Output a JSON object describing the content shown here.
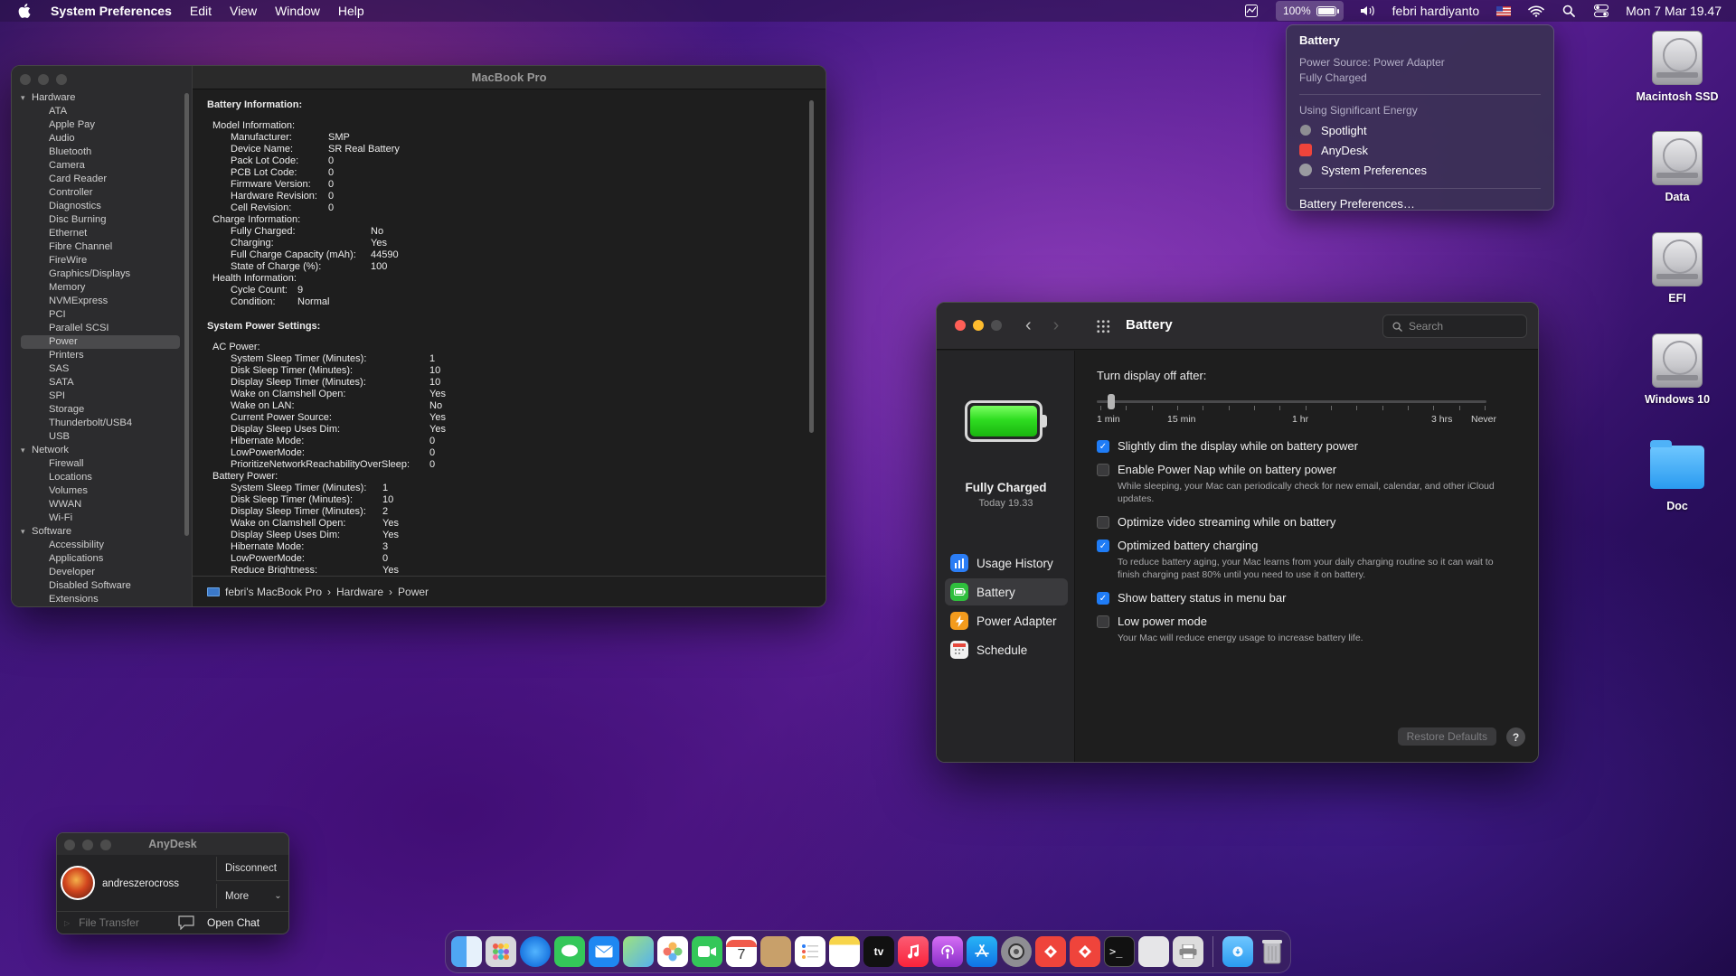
{
  "menubar": {
    "app_name": "System Preferences",
    "menus": [
      "Edit",
      "View",
      "Window",
      "Help"
    ],
    "battery_percent": "100%",
    "user": "febri hardiyanto",
    "datetime": "Mon 7 Mar  19.47"
  },
  "battery_menu": {
    "title": "Battery",
    "power_source": "Power Source: Power Adapter",
    "status": "Fully Charged",
    "energy_header": "Using Significant Energy",
    "apps": [
      "Spotlight",
      "AnyDesk",
      "System Preferences"
    ],
    "footer": "Battery Preferences…"
  },
  "sysinfo": {
    "window_title": "MacBook Pro",
    "tree": {
      "hardware_label": "Hardware",
      "hardware": [
        "ATA",
        "Apple Pay",
        "Audio",
        "Bluetooth",
        "Camera",
        "Card Reader",
        "Controller",
        "Diagnostics",
        "Disc Burning",
        "Ethernet",
        "Fibre Channel",
        "FireWire",
        "Graphics/Displays",
        "Memory",
        "NVMExpress",
        "PCI",
        "Parallel SCSI",
        "Power",
        "Printers",
        "SAS",
        "SATA",
        "SPI",
        "Storage",
        "Thunderbolt/USB4",
        "USB"
      ],
      "network_label": "Network",
      "network": [
        "Firewall",
        "Locations",
        "Volumes",
        "WWAN",
        "Wi-Fi"
      ],
      "software_label": "Software",
      "software": [
        "Accessibility",
        "Applications",
        "Developer",
        "Disabled Software",
        "Extensions"
      ]
    },
    "battery_info_header": "Battery Information:",
    "model_header": "Model Information:",
    "model": [
      {
        "k": "Manufacturer:",
        "v": "SMP"
      },
      {
        "k": "Device Name:",
        "v": "SR Real Battery"
      },
      {
        "k": "Pack Lot Code:",
        "v": "0"
      },
      {
        "k": "PCB Lot Code:",
        "v": "0"
      },
      {
        "k": "Firmware Version:",
        "v": "0"
      },
      {
        "k": "Hardware Revision:",
        "v": "0"
      },
      {
        "k": "Cell Revision:",
        "v": "0"
      }
    ],
    "charge_header": "Charge Information:",
    "charge": [
      {
        "k": "Fully Charged:",
        "v": "No"
      },
      {
        "k": "Charging:",
        "v": "Yes"
      },
      {
        "k": "Full Charge Capacity (mAh):",
        "v": "44590"
      },
      {
        "k": "State of Charge (%):",
        "v": "100"
      }
    ],
    "health_header": "Health Information:",
    "health": [
      {
        "k": "Cycle Count:",
        "v": "9"
      },
      {
        "k": "Condition:",
        "v": "Normal"
      }
    ],
    "power_header": "System Power Settings:",
    "ac_header": "AC Power:",
    "ac": [
      {
        "k": "System Sleep Timer (Minutes):",
        "v": "1"
      },
      {
        "k": "Disk Sleep Timer (Minutes):",
        "v": "10"
      },
      {
        "k": "Display Sleep Timer (Minutes):",
        "v": "10"
      },
      {
        "k": "Wake on Clamshell Open:",
        "v": "Yes"
      },
      {
        "k": "Wake on LAN:",
        "v": "No"
      },
      {
        "k": "Current Power Source:",
        "v": "Yes"
      },
      {
        "k": "Display Sleep Uses Dim:",
        "v": "Yes"
      },
      {
        "k": "Hibernate Mode:",
        "v": "0"
      },
      {
        "k": "LowPowerMode:",
        "v": "0"
      },
      {
        "k": "PrioritizeNetworkReachabilityOverSleep:",
        "v": "0"
      }
    ],
    "bat_header": "Battery Power:",
    "bat": [
      {
        "k": "System Sleep Timer (Minutes):",
        "v": "1"
      },
      {
        "k": "Disk Sleep Timer (Minutes):",
        "v": "10"
      },
      {
        "k": "Display Sleep Timer (Minutes):",
        "v": "2"
      },
      {
        "k": "Wake on Clamshell Open:",
        "v": "Yes"
      },
      {
        "k": "Display Sleep Uses Dim:",
        "v": "Yes"
      },
      {
        "k": "Hibernate Mode:",
        "v": "3"
      },
      {
        "k": "LowPowerMode:",
        "v": "0"
      },
      {
        "k": "Reduce Brightness:",
        "v": "Yes"
      }
    ],
    "path": [
      "febri's MacBook Pro",
      "Hardware",
      "Power"
    ]
  },
  "prefs": {
    "title": "Battery",
    "search_placeholder": "Search",
    "state": "Fully Charged",
    "when": "Today 19.33",
    "nav": [
      "Usage History",
      "Battery",
      "Power Adapter",
      "Schedule"
    ],
    "display_off_label": "Turn display off after:",
    "display_off_value": "1 min",
    "ticks": [
      "1 min",
      "15 min",
      "1 hr",
      "3 hrs",
      "Never"
    ],
    "options": [
      {
        "label": "Slightly dim the display while on battery power",
        "checked": true,
        "desc": ""
      },
      {
        "label": "Enable Power Nap while on battery power",
        "checked": false,
        "desc": "While sleeping, your Mac can periodically check for new email, calendar, and other iCloud updates."
      },
      {
        "label": "Optimize video streaming while on battery",
        "checked": false,
        "desc": ""
      },
      {
        "label": "Optimized battery charging",
        "checked": true,
        "desc": "To reduce battery aging, your Mac learns from your daily charging routine so it can wait to finish charging past 80% until you need to use it on battery."
      },
      {
        "label": "Show battery status in menu bar",
        "checked": true,
        "desc": ""
      },
      {
        "label": "Low power mode",
        "checked": false,
        "desc": "Your Mac will reduce energy usage to increase battery life."
      }
    ],
    "restore": "Restore Defaults",
    "help": "?"
  },
  "anydesk": {
    "title": "AnyDesk",
    "user": "andreszerocross",
    "disconnect": "Disconnect",
    "more": "More",
    "file_transfer": "File Transfer",
    "open_chat": "Open Chat"
  },
  "desktop": [
    "Macintosh SSD",
    "Data",
    "EFI",
    "Windows 10",
    "Doc"
  ],
  "dock_calendar_day": "7",
  "dock_tv": "tv"
}
